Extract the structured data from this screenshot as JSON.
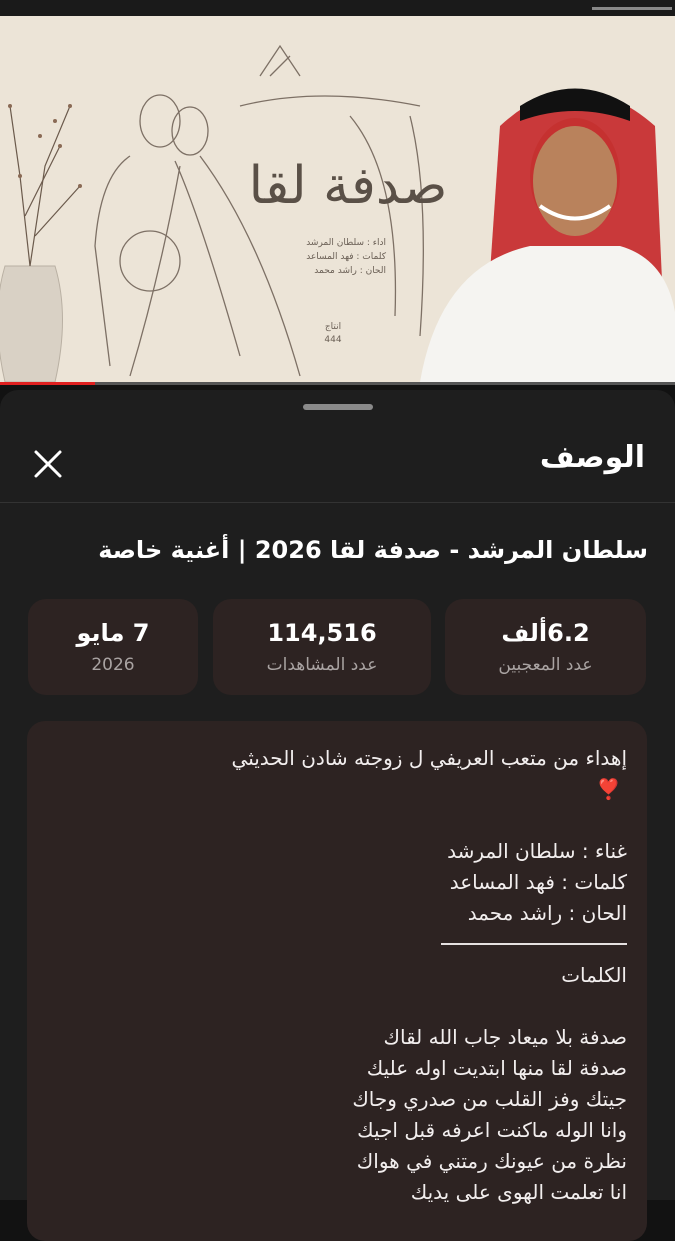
{
  "video": {
    "title_art": "صدفة لقا",
    "credits": [
      "اداء : سلطان المرشد",
      "كلمات : فهد المساعد",
      "الحان : راشد محمد"
    ],
    "production_label": "انتاج",
    "production_value": "444"
  },
  "progress": {
    "fraction": 0.14,
    "color": "#e02020"
  },
  "sheet": {
    "title": "الوصف",
    "close_icon": "close-icon",
    "video_title": "سلطان المرشد - صدفة لقا 2026 | أغنية خاصة",
    "stats": [
      {
        "value": "6.2ألف",
        "label": "عدد المعجبين"
      },
      {
        "value": "114,516",
        "label": "عدد المشاهدات"
      },
      {
        "value": "7 مايو",
        "label": "2026"
      }
    ],
    "description": {
      "dedication": "إهداء من متعب العريفي ل زوجته شادن الحديثي",
      "heart": "❣️",
      "singer": "غناء : سلطان المرشد",
      "lyricist": "كلمات : فهد المساعد",
      "composer": "الحان : راشد محمد",
      "lyrics_heading": "الكلمات",
      "lyrics": [
        "صدفة بلا ميعاد جاب الله لقاك",
        "صدفة لقا منها ابتديت اوله عليك",
        "جيتك وفز القلب من صدري وجاك",
        "وانا الوله ماكنت اعرفه قبل اجيك",
        "نظرة من عيونك رمتني في هواك",
        "انا تعلمت الهوى على يديك"
      ]
    }
  },
  "colors": {
    "sheet_bg": "#1e1e1e",
    "card_bg": "#2d2322",
    "accent": "#e02020"
  }
}
